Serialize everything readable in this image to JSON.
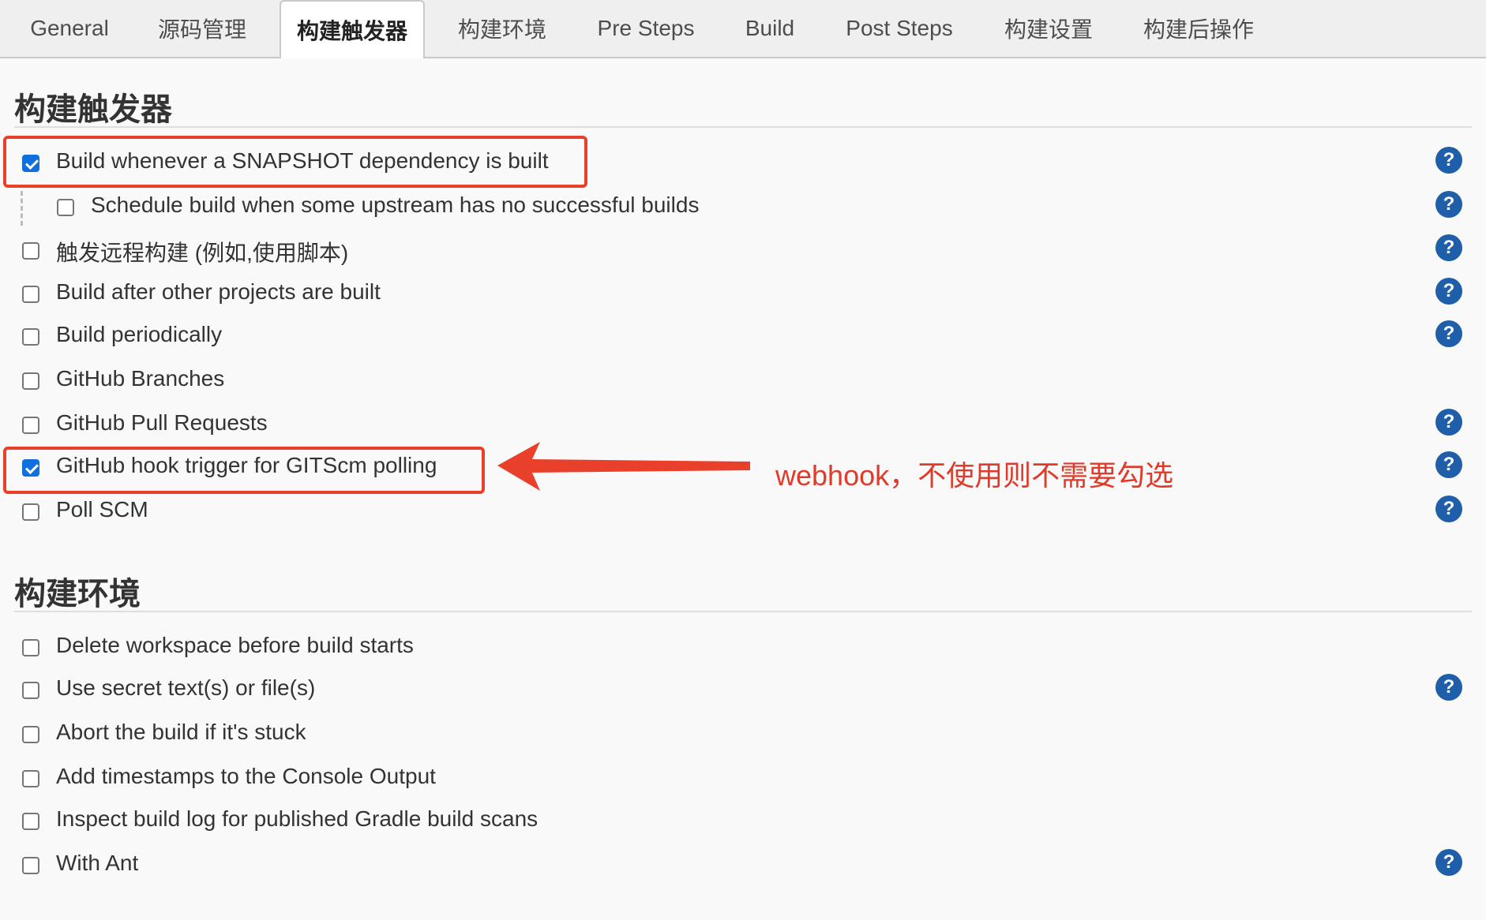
{
  "tabs": [
    {
      "label": "General",
      "active": false
    },
    {
      "label": "源码管理",
      "active": false
    },
    {
      "label": "构建触发器",
      "active": true
    },
    {
      "label": "构建环境",
      "active": false
    },
    {
      "label": "Pre Steps",
      "active": false
    },
    {
      "label": "Build",
      "active": false
    },
    {
      "label": "Post Steps",
      "active": false
    },
    {
      "label": "构建设置",
      "active": false
    },
    {
      "label": "构建后操作",
      "active": false
    }
  ],
  "triggers": {
    "title": "构建触发器",
    "options": [
      {
        "label": "Build whenever a SNAPSHOT dependency is built",
        "checked": true,
        "help": true,
        "highlighted": true
      },
      {
        "label": "Schedule build when some upstream has no successful builds",
        "checked": false,
        "help": true,
        "nested": true
      },
      {
        "label": "触发远程构建 (例如,使用脚本)",
        "checked": false,
        "help": true
      },
      {
        "label": "Build after other projects are built",
        "checked": false,
        "help": true
      },
      {
        "label": "Build periodically",
        "checked": false,
        "help": true
      },
      {
        "label": "GitHub Branches",
        "checked": false,
        "help": false
      },
      {
        "label": "GitHub Pull Requests",
        "checked": false,
        "help": true
      },
      {
        "label": "GitHub hook trigger for GITScm polling",
        "checked": true,
        "help": true,
        "highlighted": true
      },
      {
        "label": "Poll SCM",
        "checked": false,
        "help": true
      }
    ]
  },
  "environment": {
    "title": "构建环境",
    "options": [
      {
        "label": "Delete workspace before build starts",
        "checked": false,
        "help": false
      },
      {
        "label": "Use secret text(s) or file(s)",
        "checked": false,
        "help": true
      },
      {
        "label": "Abort the build if it's stuck",
        "checked": false,
        "help": false
      },
      {
        "label": "Add timestamps to the Console Output",
        "checked": false,
        "help": false
      },
      {
        "label": "Inspect build log for published Gradle build scans",
        "checked": false,
        "help": false
      },
      {
        "label": "With Ant",
        "checked": false,
        "help": true
      }
    ]
  },
  "help_icon": {
    "glyph": "?",
    "icon": "question-circle-icon",
    "color": "#1f5ea8"
  },
  "annotation": {
    "text": "webhook，不使用则不需要勾选",
    "color": "#e03b2a"
  },
  "colors": {
    "checkbox_checked": "#0f6fde",
    "highlight": "#e8402a"
  }
}
